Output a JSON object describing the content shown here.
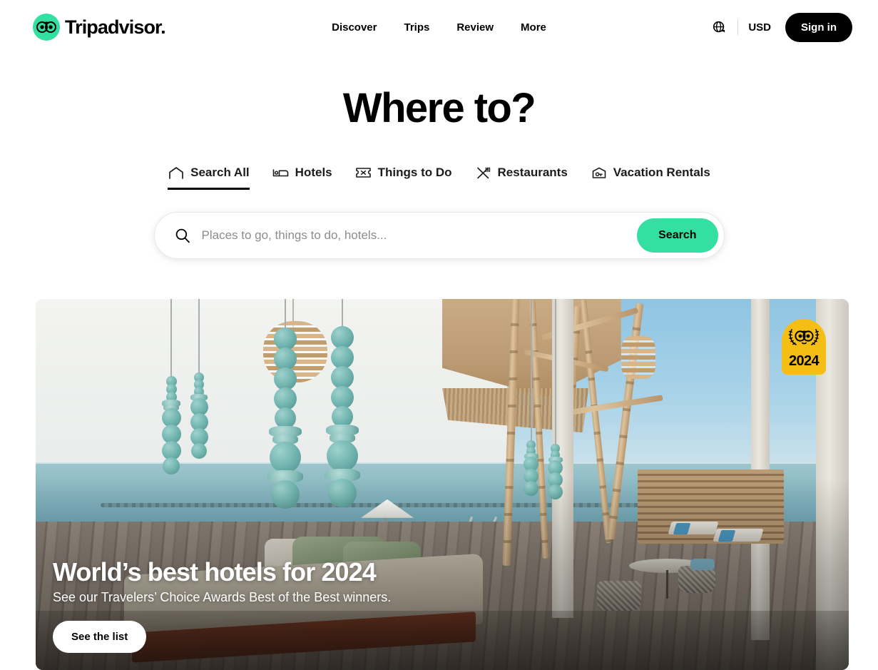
{
  "header": {
    "logo_text": "Tripadvisor",
    "logo_icon": "tripadvisor-owl-icon",
    "nav": [
      {
        "label": "Discover"
      },
      {
        "label": "Trips"
      },
      {
        "label": "Review"
      },
      {
        "label": "More"
      }
    ],
    "globe_icon": "globe-language-icon",
    "currency": "USD",
    "signin_label": "Sign in"
  },
  "hero_headline": "Where to?",
  "search": {
    "tabs": [
      {
        "label": "Search All",
        "icon": "home-outline-icon",
        "active": true
      },
      {
        "label": "Hotels",
        "icon": "bed-icon",
        "active": false
      },
      {
        "label": "Things to Do",
        "icon": "ticket-icon",
        "active": false
      },
      {
        "label": "Restaurants",
        "icon": "fork-knife-icon",
        "active": false
      },
      {
        "label": "Vacation Rentals",
        "icon": "house-key-icon",
        "active": false
      }
    ],
    "placeholder": "Places to go, things to do, hotels...",
    "value": "",
    "search_icon": "magnifier-icon",
    "button_label": "Search"
  },
  "banner": {
    "title": "World’s best hotels for 2024",
    "subtitle": "See our Travelers’ Choice Awards Best of the Best winners.",
    "cta_label": "See the list",
    "badge": {
      "year": "2024",
      "icon": "travelers-choice-owl-laurel-icon"
    },
    "image_alt": "Overwater resort villa with turquoise beaded hanging decor, daybed, infinity pool and ocean view"
  },
  "colors": {
    "brand_green": "#34e0a1",
    "badge_gold": "#f5be15",
    "text_black": "#000000",
    "placeholder_grey": "#8c8c8c"
  }
}
